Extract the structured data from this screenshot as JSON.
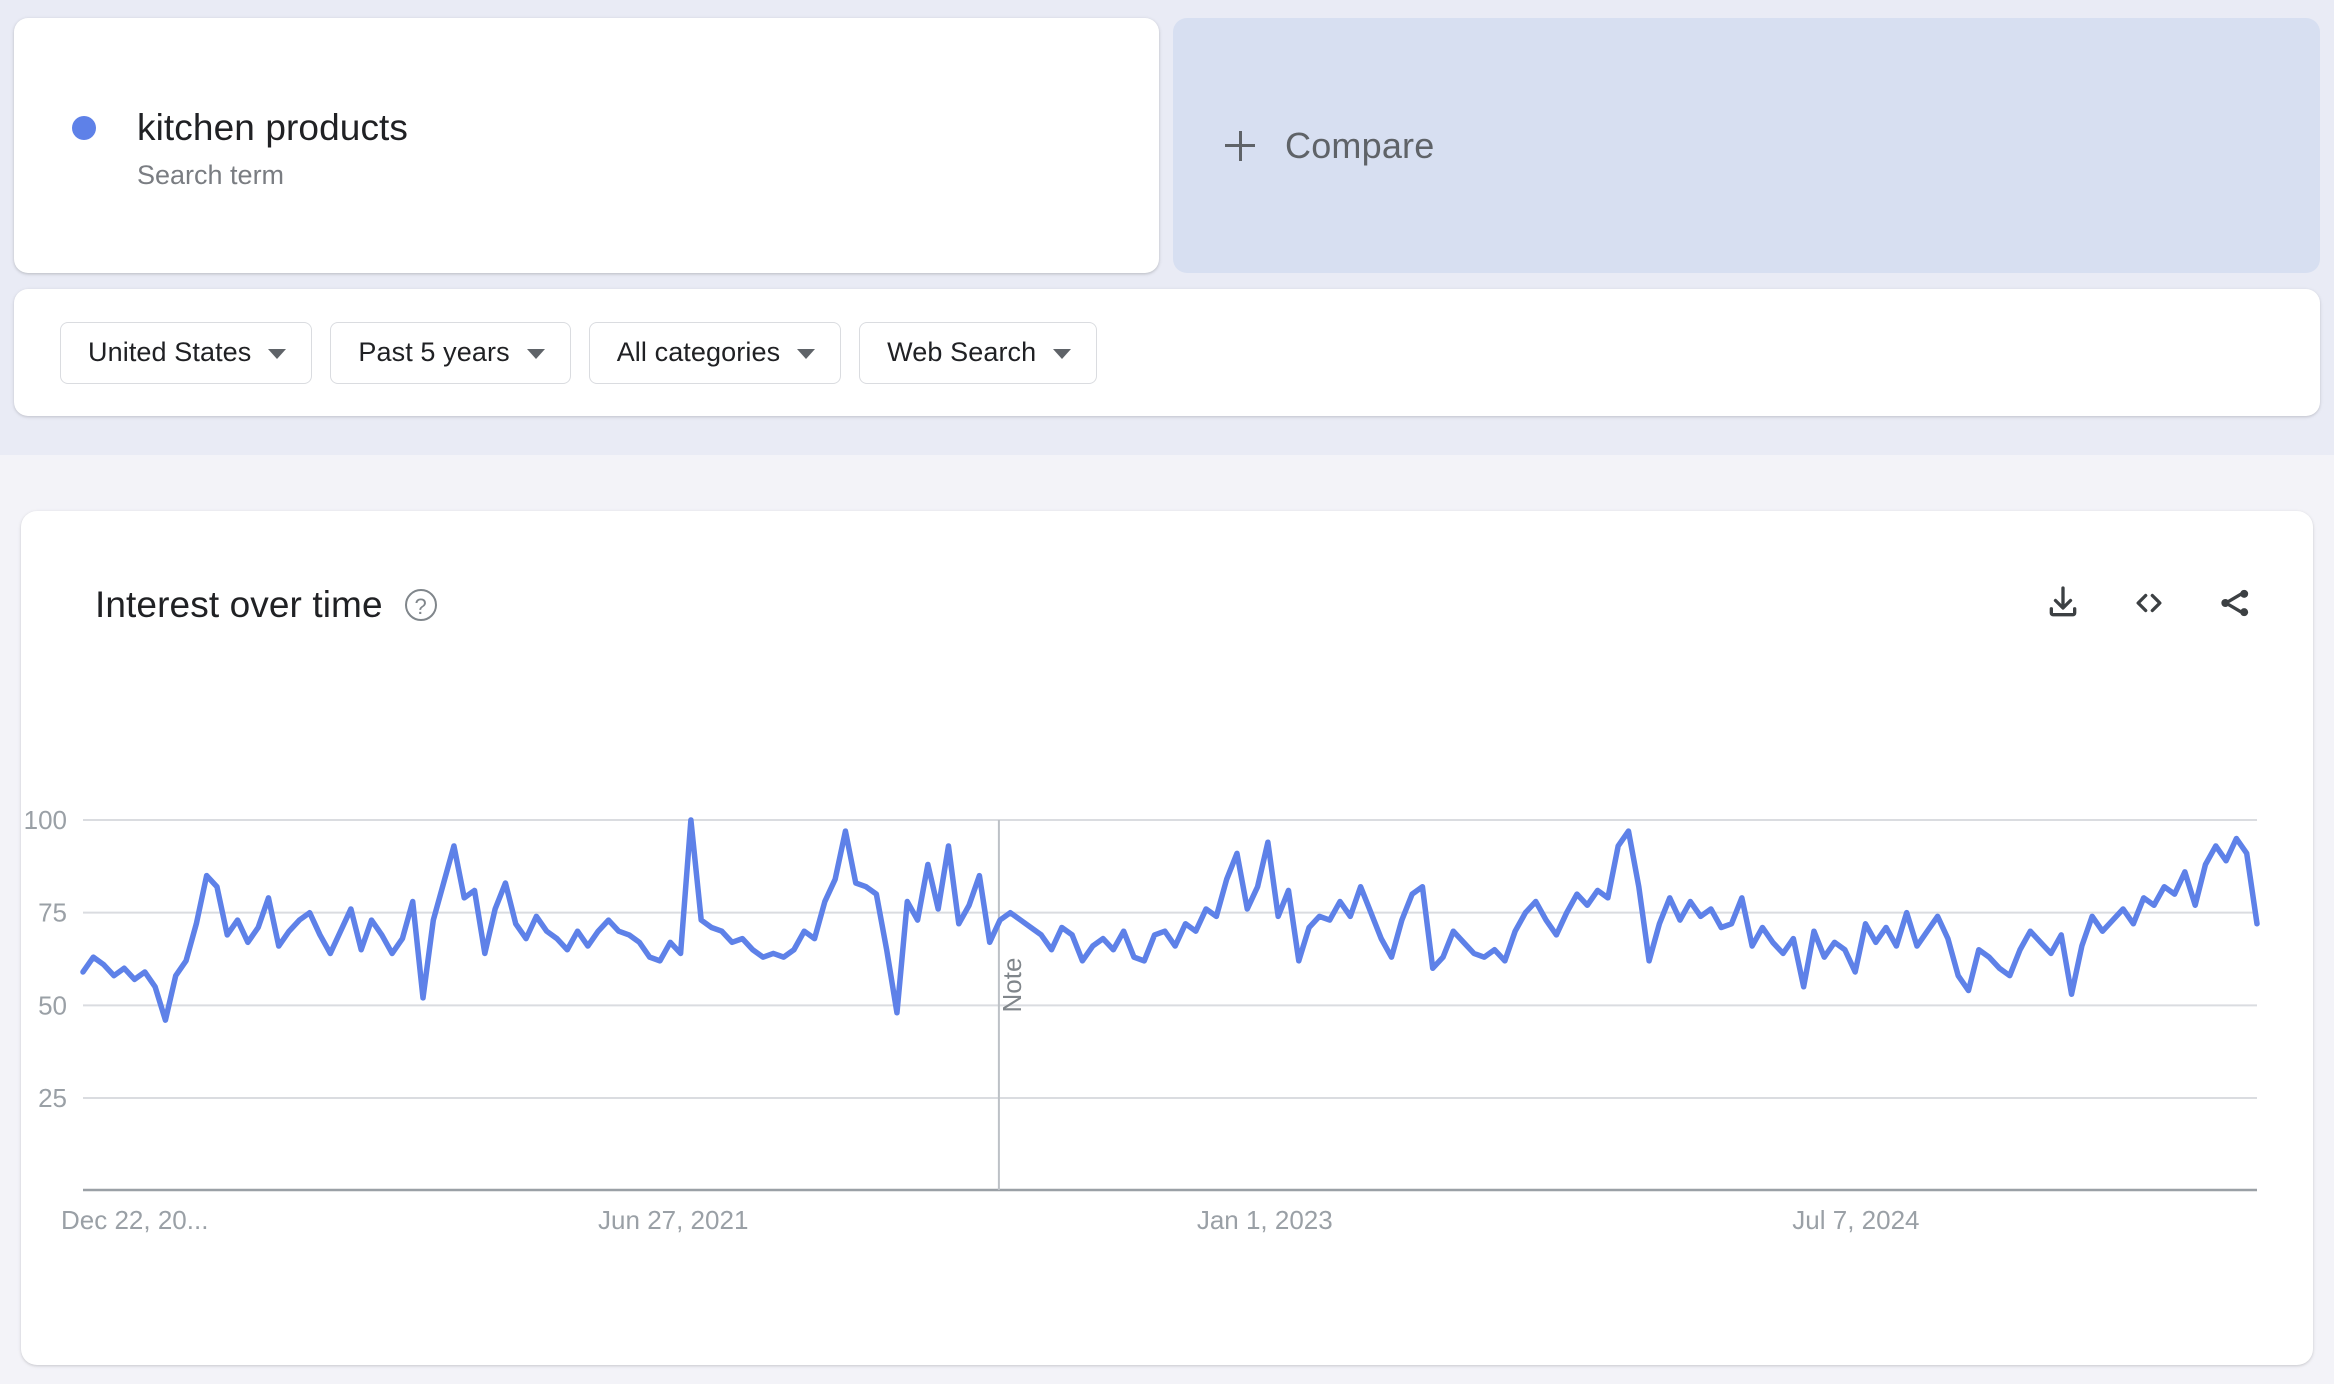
{
  "theme": {
    "page_bg": "#f3f3f8",
    "top_band_bg": "#e9ebf5",
    "card_bg": "#ffffff",
    "compare_bg": "#d7dff1",
    "series_color": "#5e81e8",
    "text_primary": "#202124",
    "text_secondary": "#5f6368",
    "text_muted": "#9aa0a6",
    "gridline": "#dadce0"
  },
  "search_term": {
    "label": "kitchen products",
    "type_label": "Search term",
    "dot_color": "#5e81e8"
  },
  "compare": {
    "label": "Compare",
    "icon": "plus-icon"
  },
  "filters": [
    {
      "label": "United States",
      "icon": "chevron-down-icon"
    },
    {
      "label": "Past 5 years",
      "icon": "chevron-down-icon"
    },
    {
      "label": "All categories",
      "icon": "chevron-down-icon"
    },
    {
      "label": "Web Search",
      "icon": "chevron-down-icon"
    }
  ],
  "interest_card": {
    "title": "Interest over time",
    "help_icon": "help-circle-icon",
    "help_glyph": "?",
    "actions": [
      {
        "name": "download-icon",
        "label": "Download"
      },
      {
        "name": "embed-code-icon",
        "label": "Embed"
      },
      {
        "name": "share-icon",
        "label": "Share"
      }
    ]
  },
  "chart_data": {
    "type": "line",
    "title": "Interest over time",
    "xlabel": "",
    "ylabel": "",
    "ylim": [
      0,
      100
    ],
    "yticks": [
      100,
      75,
      50,
      25
    ],
    "ytick_labels": [
      "100",
      "75",
      "50",
      "25"
    ],
    "xtick_labels": [
      "Dec 22, 20...",
      "Jun 27, 2021",
      "Jan 1, 2023",
      "Jul 7, 2024"
    ],
    "xtick_positions_pct": [
      0.0,
      0.2715,
      0.5436,
      0.8155
    ],
    "grid": true,
    "legend": "none",
    "series_name": "kitchen products",
    "series_color": "#5e81e8",
    "annotations": [
      {
        "type": "vertical-line",
        "label": "Note",
        "x_pct": 0.4213
      }
    ],
    "values": [
      59,
      63,
      61,
      58,
      60,
      57,
      59,
      55,
      46,
      58,
      62,
      72,
      85,
      82,
      69,
      73,
      67,
      71,
      79,
      66,
      70,
      73,
      75,
      69,
      64,
      70,
      76,
      65,
      73,
      69,
      64,
      68,
      78,
      52,
      73,
      83,
      93,
      79,
      81,
      64,
      76,
      83,
      72,
      68,
      74,
      70,
      68,
      65,
      70,
      66,
      70,
      73,
      70,
      69,
      67,
      63,
      62,
      67,
      64,
      100,
      73,
      71,
      70,
      67,
      68,
      65,
      63,
      64,
      63,
      65,
      70,
      68,
      78,
      84,
      97,
      83,
      82,
      80,
      65,
      48,
      78,
      73,
      88,
      76,
      93,
      72,
      77,
      85,
      67,
      73,
      75,
      73,
      71,
      69,
      65,
      71,
      69,
      62,
      66,
      68,
      65,
      70,
      63,
      62,
      69,
      70,
      66,
      72,
      70,
      76,
      74,
      84,
      91,
      76,
      82,
      94,
      74,
      81,
      62,
      71,
      74,
      73,
      78,
      74,
      82,
      75,
      68,
      63,
      73,
      80,
      82,
      60,
      63,
      70,
      67,
      64,
      63,
      65,
      62,
      70,
      75,
      78,
      73,
      69,
      75,
      80,
      77,
      81,
      79,
      93,
      97,
      82,
      62,
      72,
      79,
      73,
      78,
      74,
      76,
      71,
      72,
      79,
      66,
      71,
      67,
      64,
      68,
      55,
      70,
      63,
      67,
      65,
      59,
      72,
      67,
      71,
      66,
      75,
      66,
      70,
      74,
      68,
      58,
      54,
      65,
      63,
      60,
      58,
      65,
      70,
      67,
      64,
      69,
      53,
      66,
      74,
      70,
      73,
      76,
      72,
      79,
      77,
      82,
      80,
      86,
      77,
      88,
      93,
      89,
      95,
      91,
      72
    ]
  }
}
